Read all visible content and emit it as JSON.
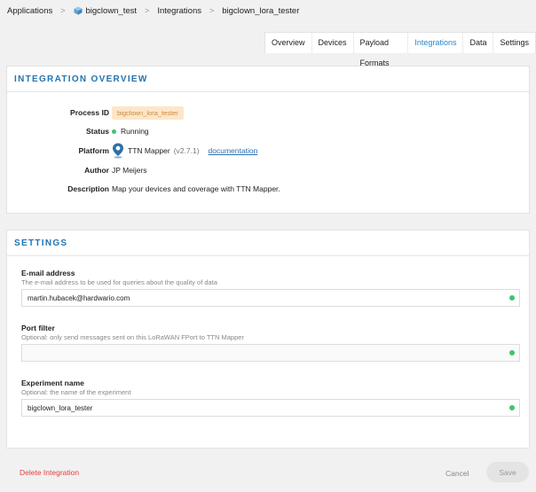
{
  "breadcrumb": {
    "items": [
      "Applications",
      "bigclown_test",
      "Integrations",
      "bigclown_lora_tester"
    ],
    "separator": ">"
  },
  "tabs": [
    {
      "label": "Overview",
      "active": false
    },
    {
      "label": "Devices",
      "active": false
    },
    {
      "label": "Payload Formats",
      "active": false
    },
    {
      "label": "Integrations",
      "active": true
    },
    {
      "label": "Data",
      "active": false
    },
    {
      "label": "Settings",
      "active": false
    }
  ],
  "overview": {
    "title": "INTEGRATION OVERVIEW",
    "process_id_label": "Process ID",
    "process_id": "bigclown_lora_tester",
    "status_label": "Status",
    "status": "Running",
    "platform_label": "Platform",
    "platform_name": "TTN Mapper",
    "platform_version": "(v2.7.1)",
    "platform_link": "documentation",
    "author_label": "Author",
    "author": "JP Meijers",
    "description_label": "Description",
    "description": "Map your devices and coverage with TTN Mapper."
  },
  "settings": {
    "title": "SETTINGS",
    "fields": [
      {
        "label": "E-mail address",
        "description": "The e-mail address to be used for queries about the quality of data",
        "value": "martin.hubacek@hardwario.com"
      },
      {
        "label": "Port filter",
        "description": "Optional: only send messages sent on this LoRaWAN FPort to TTN Mapper",
        "value": ""
      },
      {
        "label": "Experiment name",
        "description": "Optional: the name of the experiment",
        "value": "bigclown_lora_tester"
      }
    ]
  },
  "footer": {
    "delete_label": "Delete Integration",
    "cancel_label": "Cancel",
    "save_label": "Save"
  },
  "colors": {
    "accent": "#2274b1",
    "active_tab": "#2a87c6",
    "status_ok": "#3ec46d",
    "danger": "#e2423c",
    "badge_bg": "#fde6c8"
  },
  "icons": {
    "app": "cube-icon",
    "platform": "map-pin-icon"
  }
}
